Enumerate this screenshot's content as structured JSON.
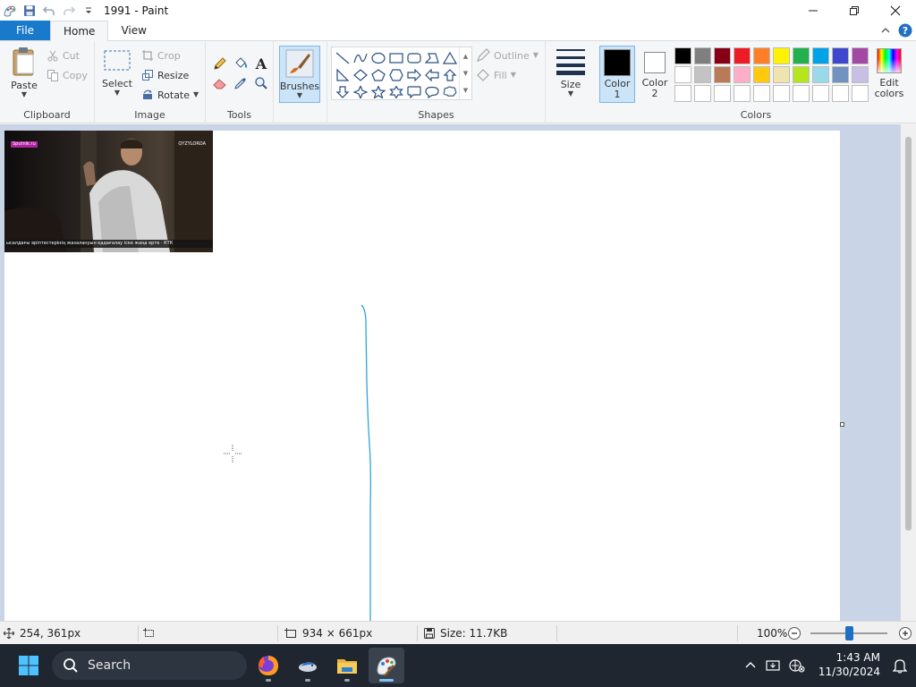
{
  "title_bar": {
    "title": "1991 - Paint"
  },
  "tabs": {
    "file": "File",
    "home": "Home",
    "view": "View"
  },
  "ribbon": {
    "clipboard": {
      "label": "Clipboard",
      "paste": "Paste",
      "cut": "Cut",
      "copy": "Copy"
    },
    "image": {
      "label": "Image",
      "select": "Select",
      "crop": "Crop",
      "resize": "Resize",
      "rotate": "Rotate"
    },
    "tools": {
      "label": "Tools"
    },
    "brushes": {
      "label": "Brushes"
    },
    "shapes": {
      "label": "Shapes",
      "outline": "Outline",
      "fill": "Fill"
    },
    "size": {
      "label": "Size"
    },
    "colors": {
      "label": "Colors",
      "color1": "Color",
      "color1_num": "1",
      "color2": "Color",
      "color2_num": "2",
      "edit_colors_1": "Edit",
      "edit_colors_2": "colors",
      "color1_value": "#000000",
      "color2_value": "#ffffff",
      "palette": [
        "#000000",
        "#7f7f7f",
        "#880015",
        "#ed1c24",
        "#ff7f27",
        "#fff200",
        "#22b14c",
        "#00a2e8",
        "#3f48cc",
        "#a349a4",
        "#ffffff",
        "#c3c3c3",
        "#b97a57",
        "#ffaec9",
        "#ffc90e",
        "#efe4b0",
        "#b5e61d",
        "#99d9ea",
        "#7092be",
        "#c8bfe7",
        "#ffffff",
        "#ffffff",
        "#ffffff",
        "#ffffff",
        "#ffffff",
        "#ffffff",
        "#ffffff",
        "#ffffff",
        "#ffffff",
        "#ffffff"
      ]
    }
  },
  "thumbnail": {
    "badge": "Sputnik.ru",
    "top_right": "QYZYLORDA",
    "ticker": "ысалдағы әріптестерінің жазалануын қадағалау іске жаңа ерте · КТК"
  },
  "status_bar": {
    "cursor_pos": "254, 361px",
    "canvas_size": "934 × 661px",
    "file_size": "Size: 11.7KB",
    "zoom": "100%",
    "zoom_fraction": 0.5
  },
  "taskbar": {
    "search": "Search",
    "time": "1:43 AM",
    "date": "11/30/2024"
  }
}
